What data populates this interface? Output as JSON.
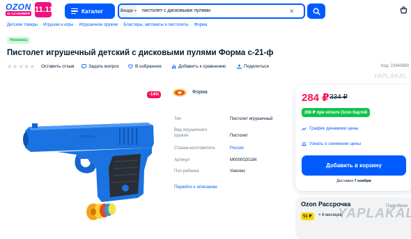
{
  "header": {
    "logo_word": "OZON",
    "logo_promo": "11–14 НОЯБРЯ",
    "logo_date": "11.11",
    "catalog_label": "Каталог",
    "search_scope": "Везде",
    "search_value": "пистолет с дисковыми пулями"
  },
  "breadcrumbs": [
    "Детские товары",
    "Игрушки и игры",
    "Игрушечное оружие",
    "Бластеры, автоматы и пистолеты",
    "Форма"
  ],
  "badge_new": "Новинка",
  "product": {
    "title": "Пистолет игрушечный детский с дисковыми пулями Форма с-21-ф",
    "code": "Код: 23943980",
    "discount": "-14%",
    "brand": "Форма"
  },
  "actions": {
    "review": "Оставить отзыв",
    "question": "Задать вопрос",
    "favorite": "В избранное",
    "compare": "Добавить к сравнению",
    "share": "Поделиться"
  },
  "specs": [
    {
      "key": "Тип",
      "value": "Пистолет игрушечный"
    },
    {
      "key": "Вид игрушечного оружия",
      "value": "Пистолет"
    },
    {
      "key": "Страна-изготовитель",
      "value": "Россия"
    },
    {
      "key": "Артикул",
      "value": "М0000020184"
    },
    {
      "key": "Пол ребенка",
      "value": "Унисекс"
    }
  ],
  "desc_link": "Перейти к описанию",
  "price_card": {
    "price": "284 ₽",
    "old_price": "334 ₽",
    "ozon_card_price": "268 ₽ при оплате Ozon Картой",
    "price_history": "График динамики цены",
    "price_drop": "Узнать о снижении цены",
    "add_to_cart": "Добавить в корзину",
    "delivery_prefix": "Доставка",
    "delivery_date": "7 ноября"
  },
  "installment": {
    "title": "Ozon Рассрочка",
    "pay": "51 ₽",
    "months": "× 6 месяцев",
    "more": "Подробнее"
  },
  "watermark": "YAPLAKAL.COM",
  "colors": {
    "primary": "#005bff",
    "price": "#f91155",
    "green": "#10c44c",
    "promo": "#f1117e",
    "gun_blue": "#1976e6"
  }
}
